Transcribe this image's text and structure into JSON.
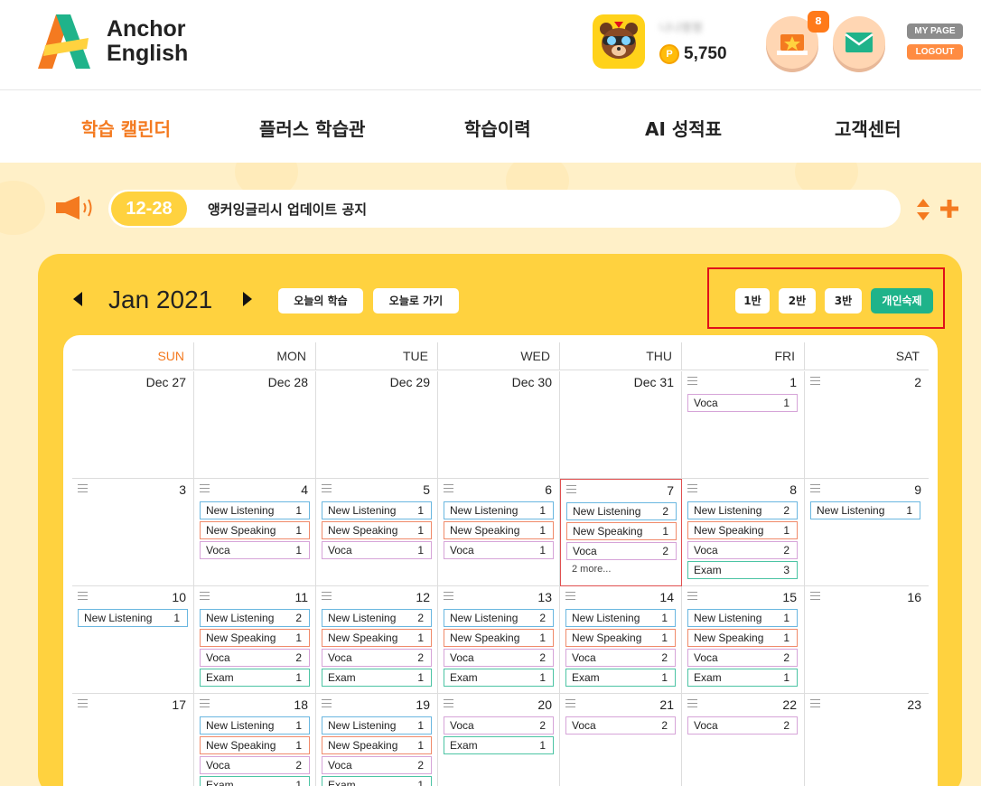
{
  "brand": {
    "name_line1": "Anchor",
    "name_line2": "English"
  },
  "user": {
    "name": "나나평평",
    "points": "5,750",
    "coin_glyph": "P"
  },
  "header": {
    "reward_badge": "8",
    "mypage_label": "MY PAGE",
    "logout_label": "LOGOUT"
  },
  "nav": [
    {
      "label": "학습 캘린더",
      "active": true
    },
    {
      "label": "플러스 학습관",
      "active": false
    },
    {
      "label": "학습이력",
      "active": false
    },
    {
      "label": "AI 성적표",
      "active": false
    },
    {
      "label": "고객센터",
      "active": false
    }
  ],
  "notice": {
    "date": "12-28",
    "text": "앵커잉글리시 업데이트 공지"
  },
  "calendar": {
    "month_label": "Jan 2021",
    "today_study_label": "오늘의 학습",
    "goto_today_label": "오늘로 가기",
    "class_buttons": [
      "1반",
      "2반",
      "3반",
      "개인숙제"
    ],
    "weekdays": [
      "SUN",
      "MON",
      "TUE",
      "WED",
      "THU",
      "FRI",
      "SAT"
    ],
    "weeks": [
      [
        {
          "day": "Dec 27",
          "events": []
        },
        {
          "day": "Dec 28",
          "events": []
        },
        {
          "day": "Dec 29",
          "events": []
        },
        {
          "day": "Dec 30",
          "events": []
        },
        {
          "day": "Dec 31",
          "events": []
        },
        {
          "day": "1",
          "menu": true,
          "events": [
            {
              "name": "Voca",
              "count": "1",
              "type": "voca"
            }
          ]
        },
        {
          "day": "2",
          "menu": true,
          "events": []
        }
      ],
      [
        {
          "day": "3",
          "menu": true,
          "events": []
        },
        {
          "day": "4",
          "menu": true,
          "events": [
            {
              "name": "New Listening",
              "count": "1",
              "type": "listening"
            },
            {
              "name": "New Speaking",
              "count": "1",
              "type": "speaking"
            },
            {
              "name": "Voca",
              "count": "1",
              "type": "voca"
            }
          ]
        },
        {
          "day": "5",
          "menu": true,
          "events": [
            {
              "name": "New Listening",
              "count": "1",
              "type": "listening"
            },
            {
              "name": "New Speaking",
              "count": "1",
              "type": "speaking"
            },
            {
              "name": "Voca",
              "count": "1",
              "type": "voca"
            }
          ]
        },
        {
          "day": "6",
          "menu": true,
          "events": [
            {
              "name": "New Listening",
              "count": "1",
              "type": "listening"
            },
            {
              "name": "New Speaking",
              "count": "1",
              "type": "speaking"
            },
            {
              "name": "Voca",
              "count": "1",
              "type": "voca"
            }
          ]
        },
        {
          "day": "7",
          "menu": true,
          "today": true,
          "more": "2 more...",
          "events": [
            {
              "name": "New Listening",
              "count": "2",
              "type": "listening"
            },
            {
              "name": "New Speaking",
              "count": "1",
              "type": "speaking"
            },
            {
              "name": "Voca",
              "count": "2",
              "type": "voca"
            }
          ]
        },
        {
          "day": "8",
          "menu": true,
          "events": [
            {
              "name": "New Listening",
              "count": "2",
              "type": "listening"
            },
            {
              "name": "New Speaking",
              "count": "1",
              "type": "speaking"
            },
            {
              "name": "Voca",
              "count": "2",
              "type": "voca"
            },
            {
              "name": "Exam",
              "count": "3",
              "type": "exam"
            }
          ]
        },
        {
          "day": "9",
          "menu": true,
          "events": [
            {
              "name": "New Listening",
              "count": "1",
              "type": "listening"
            }
          ]
        }
      ],
      [
        {
          "day": "10",
          "menu": true,
          "events": [
            {
              "name": "New Listening",
              "count": "1",
              "type": "listening"
            }
          ]
        },
        {
          "day": "11",
          "menu": true,
          "events": [
            {
              "name": "New Listening",
              "count": "2",
              "type": "listening"
            },
            {
              "name": "New Speaking",
              "count": "1",
              "type": "speaking"
            },
            {
              "name": "Voca",
              "count": "2",
              "type": "voca"
            },
            {
              "name": "Exam",
              "count": "1",
              "type": "exam"
            }
          ]
        },
        {
          "day": "12",
          "menu": true,
          "events": [
            {
              "name": "New Listening",
              "count": "2",
              "type": "listening"
            },
            {
              "name": "New Speaking",
              "count": "1",
              "type": "speaking"
            },
            {
              "name": "Voca",
              "count": "2",
              "type": "voca"
            },
            {
              "name": "Exam",
              "count": "1",
              "type": "exam"
            }
          ]
        },
        {
          "day": "13",
          "menu": true,
          "events": [
            {
              "name": "New Listening",
              "count": "2",
              "type": "listening"
            },
            {
              "name": "New Speaking",
              "count": "1",
              "type": "speaking"
            },
            {
              "name": "Voca",
              "count": "2",
              "type": "voca"
            },
            {
              "name": "Exam",
              "count": "1",
              "type": "exam"
            }
          ]
        },
        {
          "day": "14",
          "menu": true,
          "events": [
            {
              "name": "New Listening",
              "count": "1",
              "type": "listening"
            },
            {
              "name": "New Speaking",
              "count": "1",
              "type": "speaking"
            },
            {
              "name": "Voca",
              "count": "2",
              "type": "voca"
            },
            {
              "name": "Exam",
              "count": "1",
              "type": "exam"
            }
          ]
        },
        {
          "day": "15",
          "menu": true,
          "events": [
            {
              "name": "New Listening",
              "count": "1",
              "type": "listening"
            },
            {
              "name": "New Speaking",
              "count": "1",
              "type": "speaking"
            },
            {
              "name": "Voca",
              "count": "2",
              "type": "voca"
            },
            {
              "name": "Exam",
              "count": "1",
              "type": "exam"
            }
          ]
        },
        {
          "day": "16",
          "menu": true,
          "events": []
        }
      ],
      [
        {
          "day": "17",
          "menu": true,
          "events": []
        },
        {
          "day": "18",
          "menu": true,
          "events": [
            {
              "name": "New Listening",
              "count": "1",
              "type": "listening"
            },
            {
              "name": "New Speaking",
              "count": "1",
              "type": "speaking"
            },
            {
              "name": "Voca",
              "count": "2",
              "type": "voca"
            },
            {
              "name": "Exam",
              "count": "1",
              "type": "exam"
            }
          ]
        },
        {
          "day": "19",
          "menu": true,
          "events": [
            {
              "name": "New Listening",
              "count": "1",
              "type": "listening"
            },
            {
              "name": "New Speaking",
              "count": "1",
              "type": "speaking"
            },
            {
              "name": "Voca",
              "count": "2",
              "type": "voca"
            },
            {
              "name": "Exam",
              "count": "1",
              "type": "exam"
            }
          ]
        },
        {
          "day": "20",
          "menu": true,
          "events": [
            {
              "name": "Voca",
              "count": "2",
              "type": "voca"
            },
            {
              "name": "Exam",
              "count": "1",
              "type": "exam"
            }
          ]
        },
        {
          "day": "21",
          "menu": true,
          "events": [
            {
              "name": "Voca",
              "count": "2",
              "type": "voca"
            }
          ]
        },
        {
          "day": "22",
          "menu": true,
          "events": [
            {
              "name": "Voca",
              "count": "2",
              "type": "voca"
            }
          ]
        },
        {
          "day": "23",
          "menu": true,
          "events": []
        }
      ]
    ]
  },
  "colors": {
    "accent_orange": "#f47a20",
    "panel_yellow": "#ffd23f",
    "teal": "#1fb38a",
    "highlight_red": "#e0101a"
  },
  "icons": {
    "notice": "megaphone-icon",
    "reward": "trophy-icon",
    "mail": "mail-icon",
    "prev": "triangle-left-icon",
    "next": "triangle-right-icon",
    "menu": "hamburger-icon"
  }
}
